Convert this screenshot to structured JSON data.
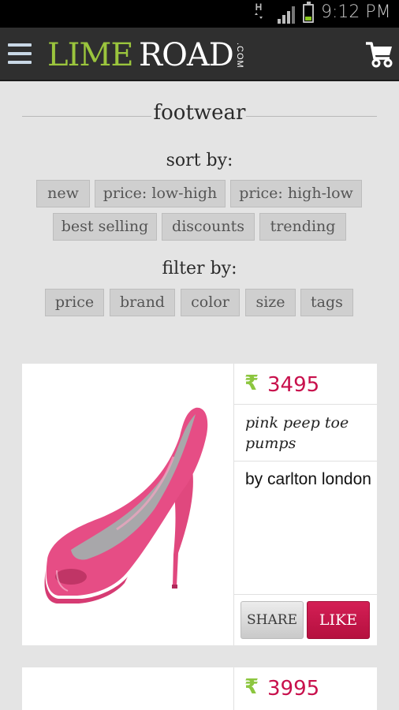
{
  "status_bar": {
    "network": "H",
    "time": "9:12 PM"
  },
  "header": {
    "logo_part1": "LIME",
    "logo_part2": "ROAD",
    "logo_suffix": ".COM"
  },
  "page": {
    "title": "footwear",
    "sort_label": "sort by:",
    "sort_options": [
      "new",
      "price: low-high",
      "price: high-low",
      "best selling",
      "discounts",
      "trending"
    ],
    "filter_label": "filter by:",
    "filter_options": [
      "price",
      "brand",
      "color",
      "size",
      "tags"
    ]
  },
  "colors": {
    "brand_green": "#9bc53d",
    "price_pink": "#c8104c",
    "like_button": "#c8174a"
  },
  "products": [
    {
      "currency": "₹",
      "price": "3495",
      "name": "pink peep toe pumps",
      "brand": "by carlton london",
      "share_label": "SHARE",
      "like_label": "LIKE"
    },
    {
      "currency": "₹",
      "price": "3995"
    }
  ]
}
